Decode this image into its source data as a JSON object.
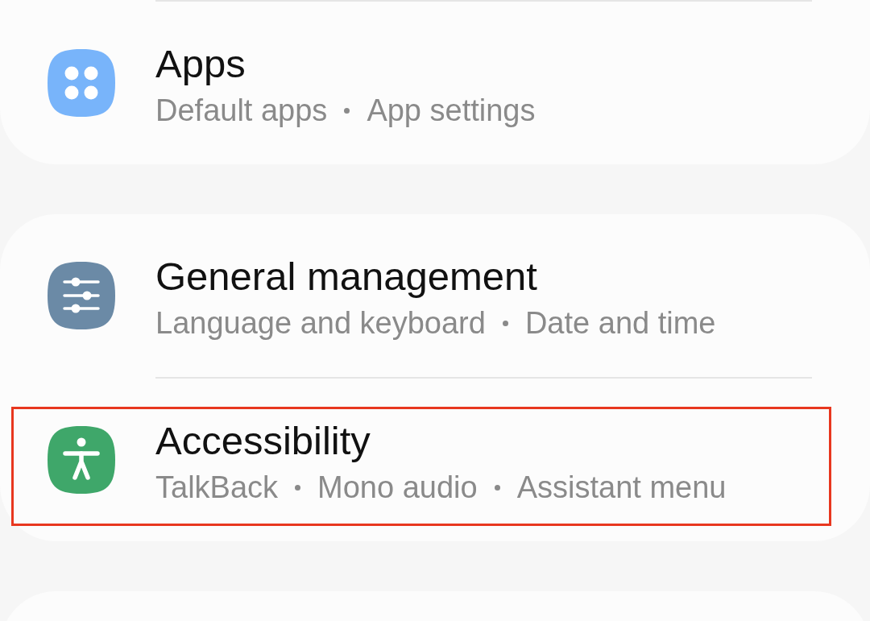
{
  "cards": [
    {
      "kind": "continued",
      "items": [
        {
          "kind": "apps",
          "color": "#78b4fa",
          "title": "Apps",
          "subtitle": [
            "Default apps",
            "App settings"
          ],
          "highlighted": false
        }
      ]
    },
    {
      "kind": "group",
      "items": [
        {
          "kind": "management",
          "color": "#6b8aa6",
          "title": "General management",
          "subtitle": [
            "Language and keyboard",
            "Date and time"
          ],
          "highlighted": false
        },
        {
          "kind": "accessibility",
          "color": "#3fa76a",
          "title": "Accessibility",
          "subtitle": [
            "TalkBack",
            "Mono audio",
            "Assistant menu"
          ],
          "highlighted": true
        }
      ]
    },
    {
      "kind": "clipped"
    }
  ]
}
